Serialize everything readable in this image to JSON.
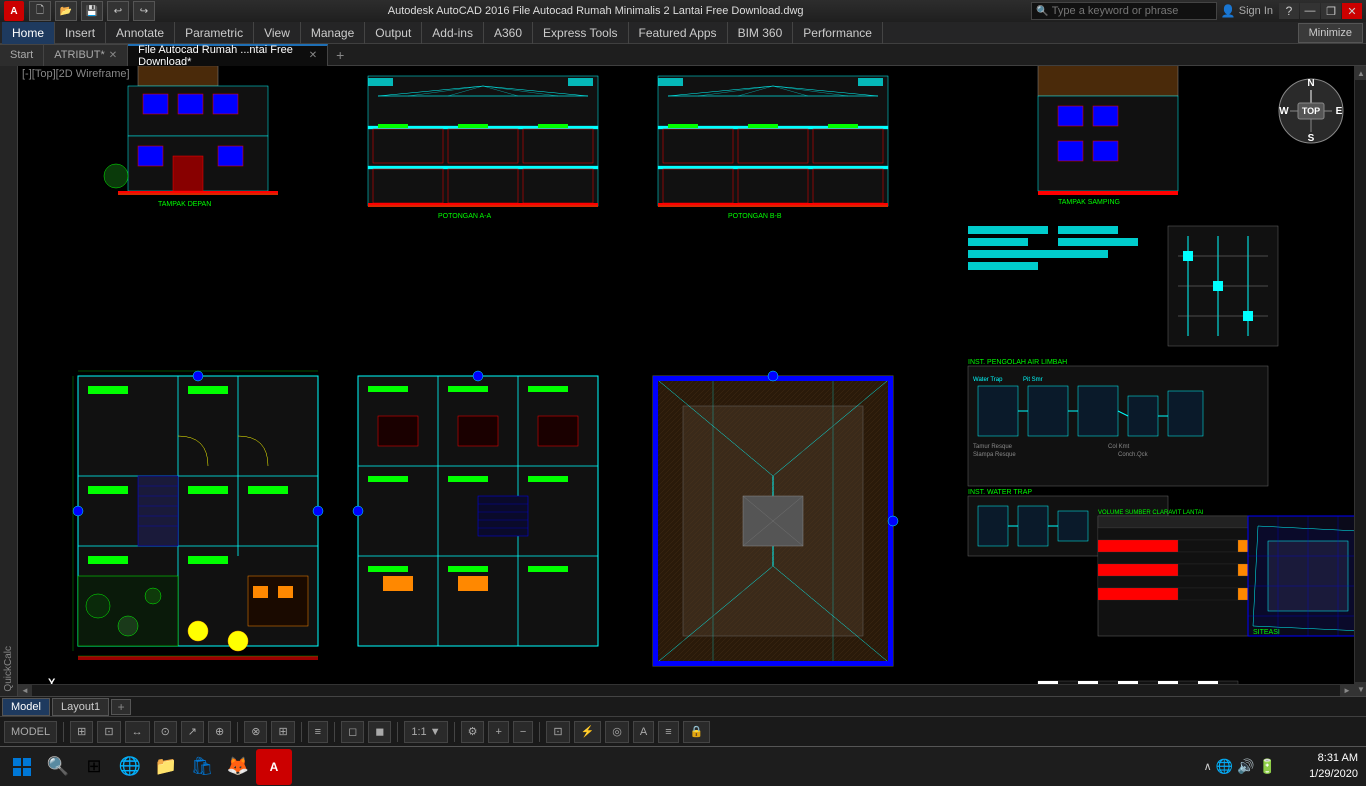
{
  "titlebar": {
    "app_icon": "A",
    "title": "Autodesk AutoCAD 2016   File Autocad Rumah Minimalis 2 Lantai Free Download.dwg",
    "search_placeholder": "Type a keyword or phrase",
    "sign_in": "Sign In",
    "minimize_label": "—",
    "restore_label": "❐",
    "close_label": "✕"
  },
  "ribbon": {
    "quick_access": [
      "💾",
      "↩",
      "↪",
      "⬛"
    ],
    "tabs": [
      {
        "label": "Home",
        "active": true
      },
      {
        "label": "Insert",
        "active": false
      },
      {
        "label": "Annotate",
        "active": false
      },
      {
        "label": "Parametric",
        "active": false
      },
      {
        "label": "View",
        "active": false
      },
      {
        "label": "Manage",
        "active": false
      },
      {
        "label": "Output",
        "active": false
      },
      {
        "label": "Add-ins",
        "active": false
      },
      {
        "label": "A360",
        "active": false
      },
      {
        "label": "Express Tools",
        "active": false
      },
      {
        "label": "Featured Apps",
        "active": false
      },
      {
        "label": "BIM 360",
        "active": false
      },
      {
        "label": "Performance",
        "active": false
      }
    ],
    "minimize_button": "Minimize"
  },
  "doc_tabs": [
    {
      "label": "Start",
      "active": false,
      "closeable": false
    },
    {
      "label": "ATRIBUT*",
      "active": false,
      "closeable": true
    },
    {
      "label": "File Autocad Rumah ...ntai Free Download*",
      "active": true,
      "closeable": true
    }
  ],
  "viewport": {
    "label": "[-][Top][2D Wireframe]",
    "model_space": true
  },
  "compass": {
    "top_label": "TOP",
    "directions": [
      "N",
      "E",
      "S",
      "W"
    ]
  },
  "status_bar": {
    "model_label": "MODEL",
    "buttons": [
      "⊞",
      "⊡",
      "↔",
      "⊙",
      "↗",
      "⊕",
      "🔍",
      "⚙",
      "+",
      "⊟",
      "≡"
    ]
  },
  "layout_tabs": [
    {
      "label": "Model",
      "active": true
    },
    {
      "label": "Layout1",
      "active": false
    }
  ],
  "taskbar": {
    "clock": "8:31 AM",
    "date": "1/29/2020",
    "icons": [
      "🔍",
      "⊞",
      "🗂",
      "🌐",
      "📁",
      "🛡",
      "🦊",
      "⚙",
      "A"
    ]
  },
  "quickcalc": {
    "label": "QuickCalc"
  }
}
